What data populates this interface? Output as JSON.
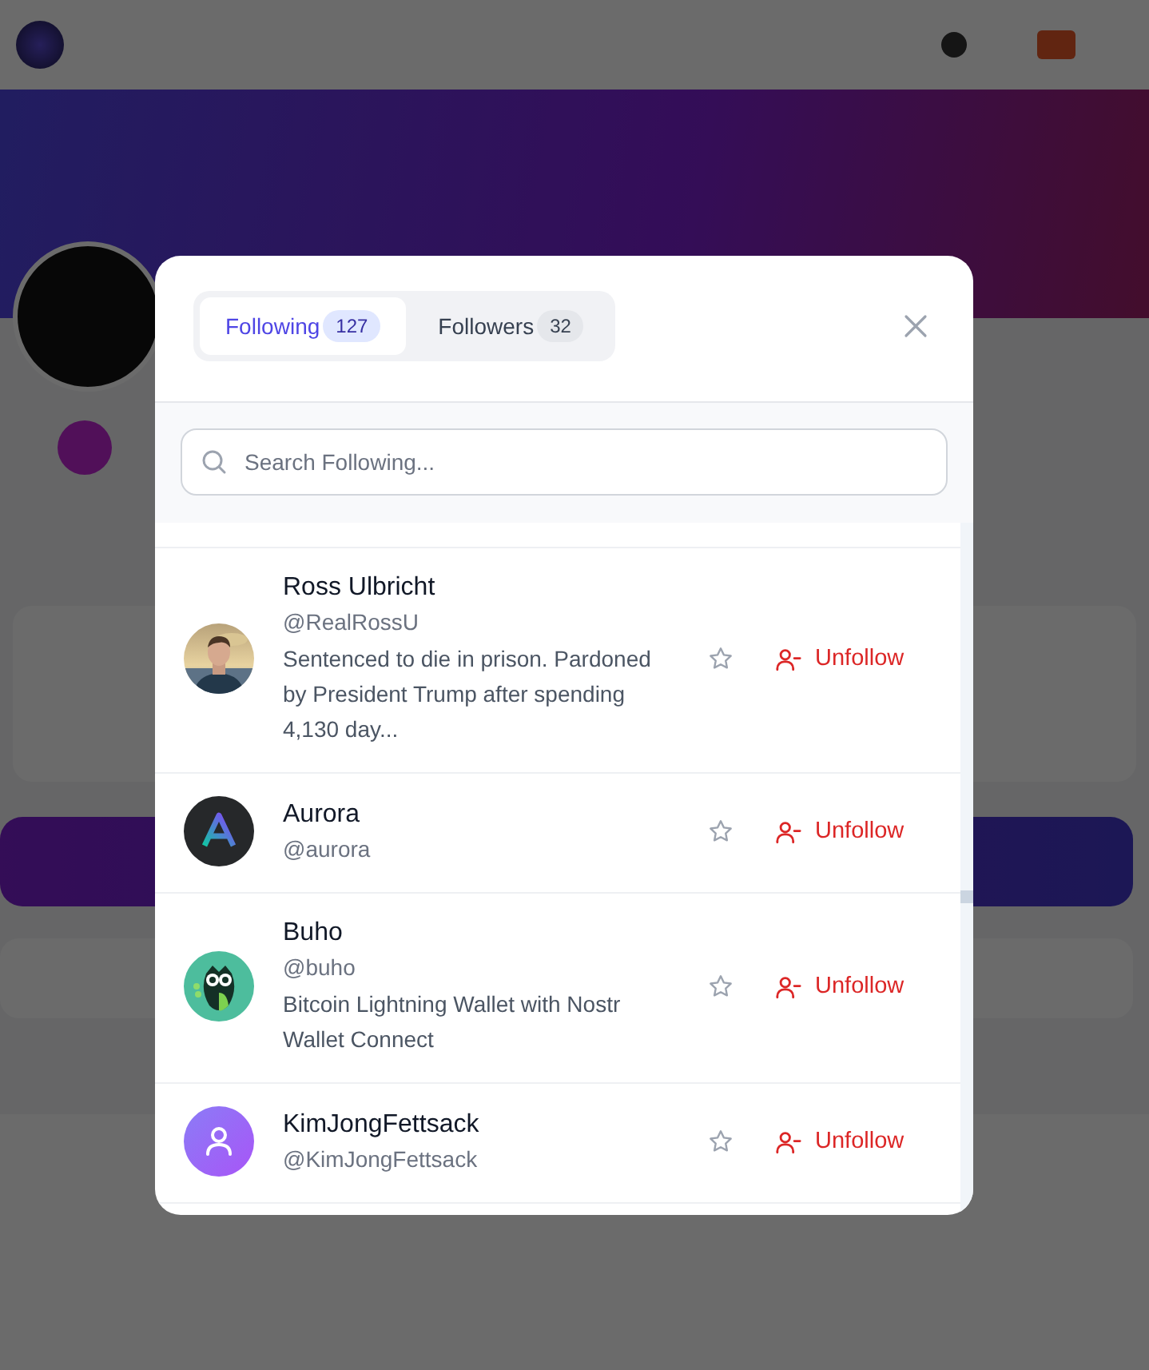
{
  "modal": {
    "tabs": [
      {
        "label": "Following",
        "count": "127",
        "selected": true
      },
      {
        "label": "Followers",
        "count": "32",
        "selected": false
      }
    ],
    "search": {
      "placeholder": "Search Following..."
    },
    "users": [
      {
        "name": "Ross Ulbricht",
        "handle": "@RealRossU",
        "bio": "Sentenced to die in prison. Pardoned by President Trump after spending 4,130 day...",
        "favorite": false,
        "action": "Unfollow"
      },
      {
        "name": "Aurora",
        "handle": "@aurora",
        "avatar": {
          "kind": "letter-logo"
        },
        "favorite": false,
        "action": "Unfollow"
      },
      {
        "name": "Buho",
        "handle": "@buho",
        "bio": "Bitcoin Lightning Wallet with Nostr Wallet Connect",
        "avatar": {
          "kind": "owl-logo"
        },
        "favorite": false,
        "action": "Unfollow"
      },
      {
        "name": "KimJongFettsack",
        "handle": "@KimJongFettsack",
        "avatar": {
          "kind": "default"
        },
        "favorite": false,
        "action": "Unfollow"
      }
    ]
  }
}
